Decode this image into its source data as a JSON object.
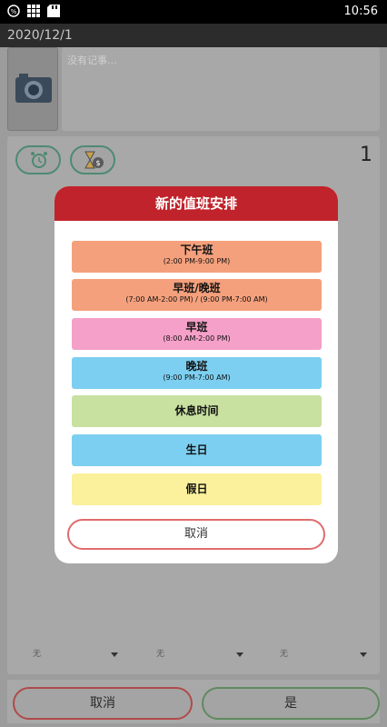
{
  "status_bar": {
    "time": "10:56"
  },
  "background": {
    "date": "2020/12/1",
    "note_placeholder": "没有记事...",
    "count": "1",
    "selects": [
      "无",
      "无",
      "无"
    ],
    "buttons": {
      "cancel": "取消",
      "yes": "是"
    }
  },
  "dialog": {
    "title": "新的值班安排",
    "shifts": [
      {
        "name": "下午班",
        "time": "(2:00 PM-9:00 PM)",
        "color": "#f4a07c"
      },
      {
        "name": "早班/晚班",
        "time": "(7:00 AM-2:00 PM) / (9:00 PM-7:00 AM)",
        "color": "#f4a07c"
      },
      {
        "name": "早班",
        "time": "(8:00 AM-2:00 PM)",
        "color": "#f4a0c8"
      },
      {
        "name": "晚班",
        "time": "(9:00 PM-7:00 AM)",
        "color": "#7ccff0"
      },
      {
        "name": "休息时间",
        "time": "",
        "color": "#c8e0a0"
      },
      {
        "name": "生日",
        "time": "",
        "color": "#7ccff0"
      },
      {
        "name": "假日",
        "time": "",
        "color": "#fbf09c"
      }
    ],
    "cancel_label": "取消"
  }
}
